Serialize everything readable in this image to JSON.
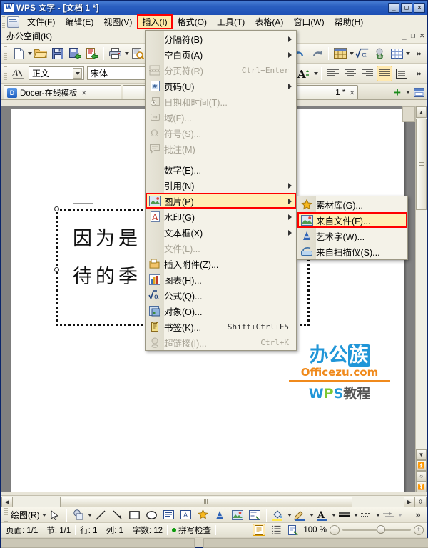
{
  "window": {
    "title": "WPS 文字 - [文档 1 *]",
    "logo_glyph": "W",
    "buttons": {
      "minimize": "_",
      "maximize": "□",
      "close": "✕"
    }
  },
  "menubar": {
    "items": [
      {
        "label": "文件(F)",
        "name": "menu-file",
        "active": false
      },
      {
        "label": "编辑(E)",
        "name": "menu-edit",
        "active": false
      },
      {
        "label": "视图(V)",
        "name": "menu-view",
        "active": false
      },
      {
        "label": "插入(I)",
        "name": "menu-insert",
        "active": true
      },
      {
        "label": "格式(O)",
        "name": "menu-format",
        "active": false
      },
      {
        "label": "工具(T)",
        "name": "menu-tools",
        "active": false
      },
      {
        "label": "表格(A)",
        "name": "menu-table",
        "active": false
      },
      {
        "label": "窗口(W)",
        "name": "menu-window",
        "active": false
      },
      {
        "label": "帮助(H)",
        "name": "menu-help",
        "active": false
      }
    ]
  },
  "workspace_row": {
    "label": "办公空间(K)",
    "minimize": "_",
    "restore": "❐",
    "close": "✕"
  },
  "format_toolbar": {
    "style_value": "正文",
    "font_value": "宋体",
    "overflow": "»"
  },
  "standard_toolbar": {
    "overflow": "»"
  },
  "tabs": {
    "items": [
      {
        "label": "Docer-在线模板",
        "icon": "D",
        "close": "✕"
      },
      {
        "label": "1 *",
        "close": "✕"
      }
    ],
    "new_tab": "+",
    "new_tab_caret": "▾"
  },
  "document": {
    "text_lines": [
      "因为是",
      "待的季"
    ],
    "char_count_hint": "12"
  },
  "insert_menu": {
    "items": [
      {
        "label": "分隔符(B)",
        "icon": "",
        "accel": "",
        "disabled": false,
        "submenu": true,
        "highlight": false
      },
      {
        "label": "空白页(A)",
        "icon": "",
        "accel": "",
        "disabled": false,
        "submenu": true,
        "highlight": false
      },
      {
        "label": "分页符(R)",
        "icon": "pagebreak",
        "accel": "Ctrl+Enter",
        "disabled": true,
        "submenu": false,
        "highlight": false
      },
      {
        "label": "页码(U)",
        "icon": "pagenum",
        "accel": "",
        "disabled": false,
        "submenu": true,
        "highlight": false
      },
      {
        "label": "日期和时间(T)...",
        "icon": "clock",
        "accel": "",
        "disabled": true,
        "submenu": false,
        "highlight": false
      },
      {
        "label": "域(F)...",
        "icon": "field",
        "accel": "",
        "disabled": true,
        "submenu": false,
        "highlight": false
      },
      {
        "label": "符号(S)...",
        "icon": "omega",
        "accel": "",
        "disabled": true,
        "submenu": false,
        "highlight": false
      },
      {
        "label": "批注(M)",
        "icon": "comment",
        "accel": "",
        "disabled": true,
        "submenu": false,
        "highlight": false
      },
      {
        "label": "SEP",
        "icon": "",
        "accel": "",
        "disabled": false,
        "submenu": false,
        "highlight": false
      },
      {
        "label": "数字(E)...",
        "icon": "",
        "accel": "",
        "disabled": false,
        "submenu": false,
        "highlight": false
      },
      {
        "label": "引用(N)",
        "icon": "",
        "accel": "",
        "disabled": false,
        "submenu": true,
        "highlight": false
      },
      {
        "label": "图片(P)",
        "icon": "picture",
        "accel": "",
        "disabled": false,
        "submenu": true,
        "highlight": true
      },
      {
        "label": "水印(G)",
        "icon": "watermark",
        "accel": "",
        "disabled": false,
        "submenu": true,
        "highlight": false
      },
      {
        "label": "文本框(X)",
        "icon": "",
        "accel": "",
        "disabled": false,
        "submenu": true,
        "highlight": false
      },
      {
        "label": "文件(L)...",
        "icon": "",
        "accel": "",
        "disabled": true,
        "submenu": false,
        "highlight": false
      },
      {
        "label": "插入附件(Z)...",
        "icon": "attach",
        "accel": "",
        "disabled": false,
        "submenu": false,
        "highlight": false
      },
      {
        "label": "图表(H)...",
        "icon": "chart",
        "accel": "",
        "disabled": false,
        "submenu": false,
        "highlight": false
      },
      {
        "label": "公式(Q)...",
        "icon": "formula",
        "accel": "",
        "disabled": false,
        "submenu": false,
        "highlight": false
      },
      {
        "label": "对象(O)...",
        "icon": "object",
        "accel": "",
        "disabled": false,
        "submenu": false,
        "highlight": false
      },
      {
        "label": "书签(K)...",
        "icon": "bookmark",
        "accel": "Shift+Ctrl+F5",
        "disabled": false,
        "submenu": false,
        "highlight": false
      },
      {
        "label": "超链接(I)...",
        "icon": "link",
        "accel": "Ctrl+K",
        "disabled": true,
        "submenu": false,
        "highlight": false
      }
    ]
  },
  "picture_submenu": {
    "items": [
      {
        "label": "素材库(G)...",
        "icon": "gallery",
        "highlight": false
      },
      {
        "label": "来自文件(F)...",
        "icon": "fromfile",
        "highlight": true
      },
      {
        "label": "艺术字(W)...",
        "icon": "wordart",
        "highlight": false
      },
      {
        "label": "来自扫描仪(S)...",
        "icon": "scanner",
        "highlight": false
      }
    ]
  },
  "drawing_toolbar": {
    "label": "绘图(R)",
    "overflow": "»"
  },
  "statusbar": {
    "page": "页面: 1/1",
    "section": "节: 1/1",
    "line": "行: 1",
    "column": "列: 1",
    "words": "字数: 12",
    "spellcheck": "拼写检查",
    "zoom": "100 %",
    "zoom_out": "−",
    "zoom_in": "+"
  },
  "watermark": {
    "line1_a": "办公",
    "line1_b": "族",
    "line2": "Officezu.com",
    "line3_a": "W",
    "line3_b": "P",
    "line3_c": "S",
    "line3_d": "教程"
  },
  "colors": {
    "accent_blue": "#2196d8",
    "accent_orange": "#f08a1c",
    "highlight_red": "#ff0000",
    "menu_highlight": "#ffefb5"
  }
}
